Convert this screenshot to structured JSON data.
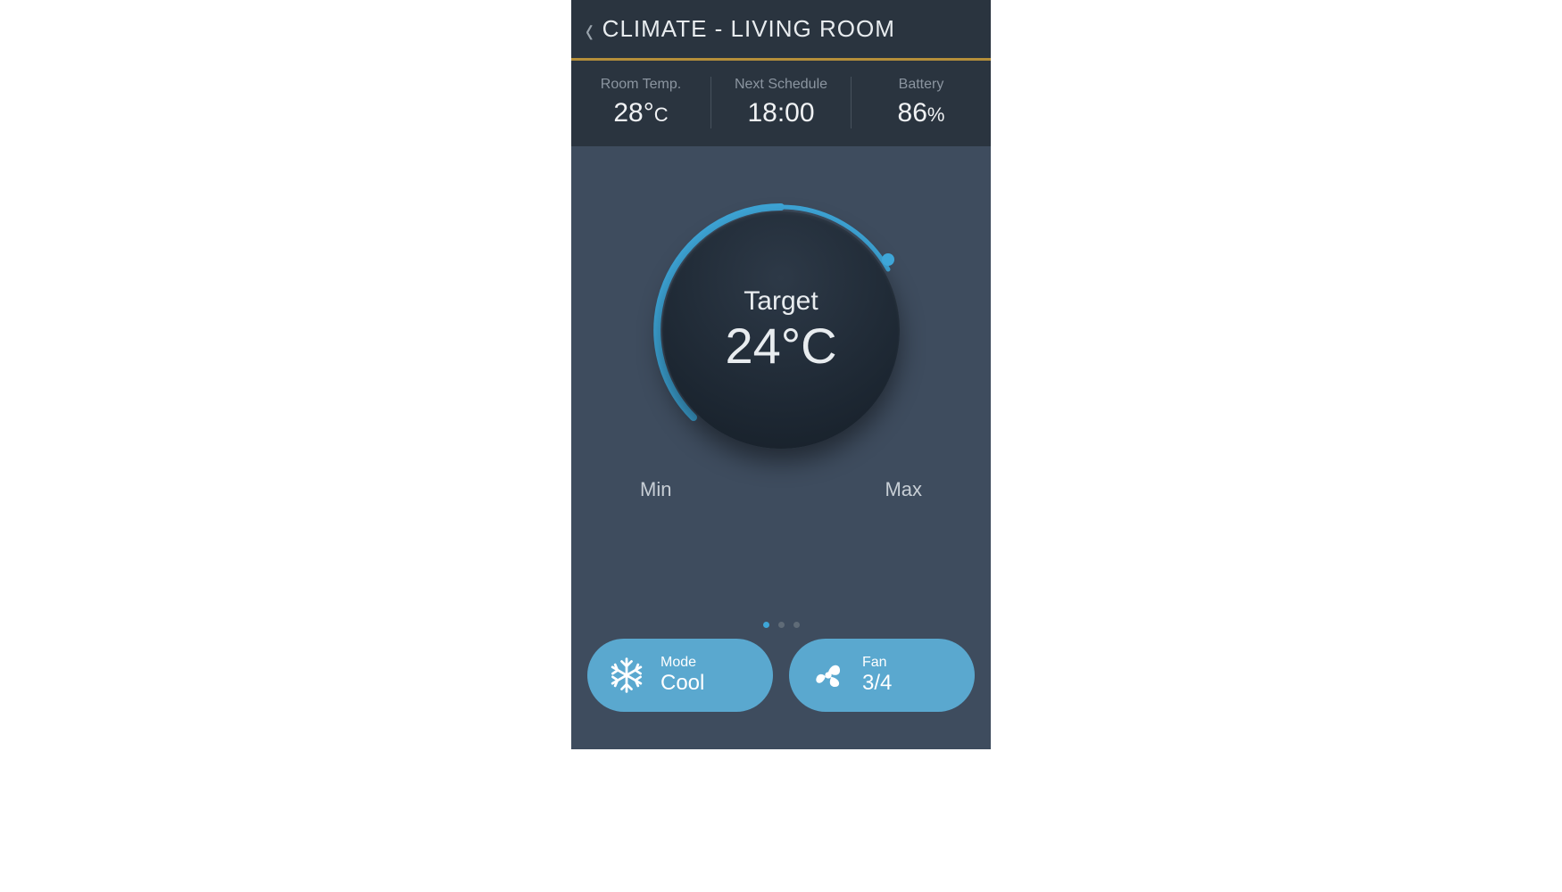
{
  "header": {
    "title": "CLIMATE - LIVING ROOM"
  },
  "stats": {
    "room_temp": {
      "label": "Room Temp.",
      "value": "28°",
      "unit": "C"
    },
    "next_schedule": {
      "label": "Next Schedule",
      "value": "18:00"
    },
    "battery": {
      "label": "Battery",
      "value": "86",
      "unit": "%"
    }
  },
  "dial": {
    "target_label": "Target",
    "target_value": "24°C",
    "min_label": "Min",
    "max_label": "Max"
  },
  "controls": {
    "mode": {
      "label": "Mode",
      "value": "Cool"
    },
    "fan": {
      "label": "Fan",
      "value": "3/4"
    }
  },
  "pager": {
    "count": 3,
    "active": 0
  },
  "colors": {
    "accent": "#3ea6d8",
    "pill": "#5aa8cf",
    "gold": "#b58f3a"
  }
}
